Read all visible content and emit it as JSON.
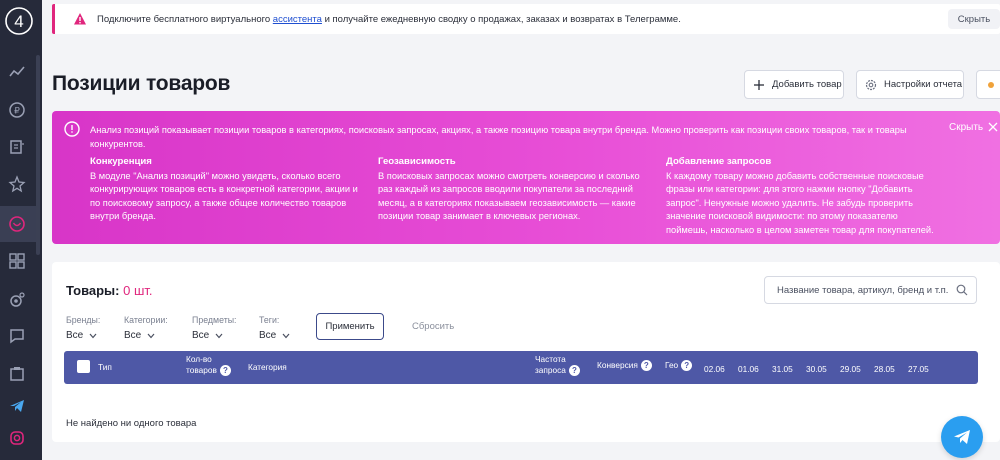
{
  "banner": {
    "text_before": "Подключите бесплатного виртуального ",
    "link": "ассистента",
    "text_after": " и получайте ежедневную сводку о продажах, заказах и возвратах в Телеграмме.",
    "hide_label": "Скрыть"
  },
  "page": {
    "title": "Позиции товаров",
    "add_product": "Добавить товар",
    "report_settings": "Настройки отчета"
  },
  "info": {
    "text": "Анализ позиций показывает позиции товаров в категориях, поисковых запросах, акциях, а также позицию товара внутри бренда. Можно проверить как позиции своих товаров, так и товары конкурентов.",
    "hide_label": "Скрыть",
    "columns": [
      {
        "title": "Конкуренция",
        "text": "В модуле \"Анализ позиций\" можно увидеть, сколько всего конкурирующих товаров есть в конкретной категории, акции и по поисковому запросу, а также общее количество товаров внутри бренда."
      },
      {
        "title": "Геозависимость",
        "text": "В поисковых запросах можно смотреть конверсию и сколько раз каждый из запросов вводили покупатели за последний месяц, а в категориях показываем геозависимость — какие позиции товар занимает в ключевых регионах."
      },
      {
        "title": "Добавление запросов",
        "text": "К каждому товару можно добавить собственные поисковые фразы или категории: для этого нажми кнопку \"Добавить запрос\". Ненужные можно удалить. Не забудь проверить значение поисковой видимости: по этому показателю поймешь, насколько в целом заметен товар для покупателей."
      }
    ]
  },
  "products": {
    "title": "Товары:",
    "count": "0 шт.",
    "search_placeholder": "Название товара, артикул, бренд и т.п.",
    "filters": [
      {
        "label": "Бренды:",
        "value": "Все"
      },
      {
        "label": "Категории:",
        "value": "Все"
      },
      {
        "label": "Предметы:",
        "value": "Все"
      },
      {
        "label": "Теги:",
        "value": "Все"
      }
    ],
    "apply_label": "Применить",
    "reset_label": "Сбросить",
    "table": {
      "type": "Тип",
      "count_line1": "Кол-во",
      "count_line2": "товаров",
      "category": "Категория",
      "freq_line1": "Частота",
      "freq_line2": "запроса",
      "conversion": "Конверсия",
      "geo": "Гео",
      "dates": [
        "02.06",
        "01.06",
        "31.05",
        "30.05",
        "29.05",
        "28.05",
        "27.05"
      ]
    },
    "empty_text": "Не найдено ни одного товара"
  },
  "icons": {
    "help": "?"
  },
  "colors": {
    "accent": "#e0267d",
    "table_header": "#4e58a6",
    "sidebar": "#262a3a",
    "telegram": "#2a9ef0"
  }
}
